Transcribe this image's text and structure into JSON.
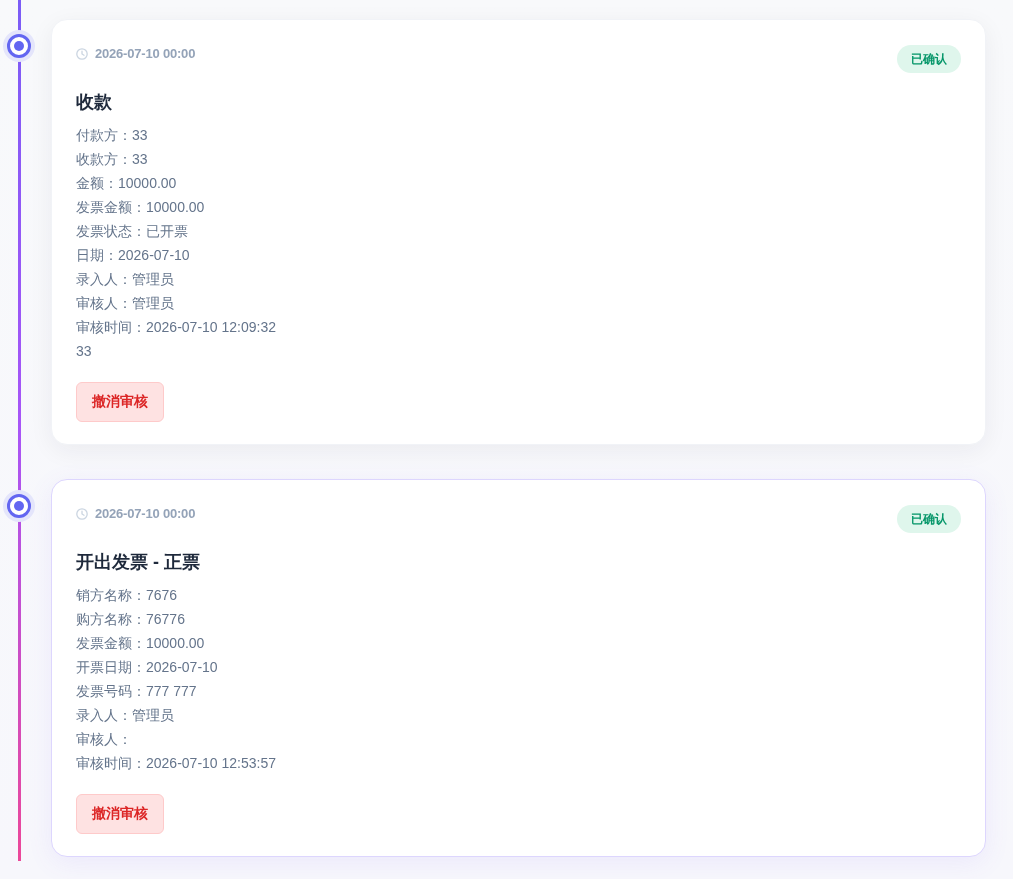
{
  "timeline": {
    "entries": [
      {
        "time": "2026-07-10 00:00",
        "status": "已确认",
        "title": "收款",
        "details": [
          "付款方：33",
          "收款方：33",
          "金额：10000.00",
          "发票金额：10000.00",
          "发票状态：已开票",
          "日期：2026-07-10",
          "录入人：管理员",
          "审核人：管理员",
          "审核时间：2026-07-10 12:09:32",
          "33"
        ],
        "action": "撤消审核",
        "highlighted": false
      },
      {
        "time": "2026-07-10 00:00",
        "status": "已确认",
        "title": "开出发票 - 正票",
        "details": [
          "销方名称：7676",
          "购方名称：76776",
          "发票金额：10000.00",
          "开票日期：2026-07-10",
          "发票号码：777 777",
          "录入人：管理员",
          "审核人：",
          "审核时间：2026-07-10 12:53:57"
        ],
        "action": "撤消审核",
        "highlighted": true
      }
    ]
  }
}
